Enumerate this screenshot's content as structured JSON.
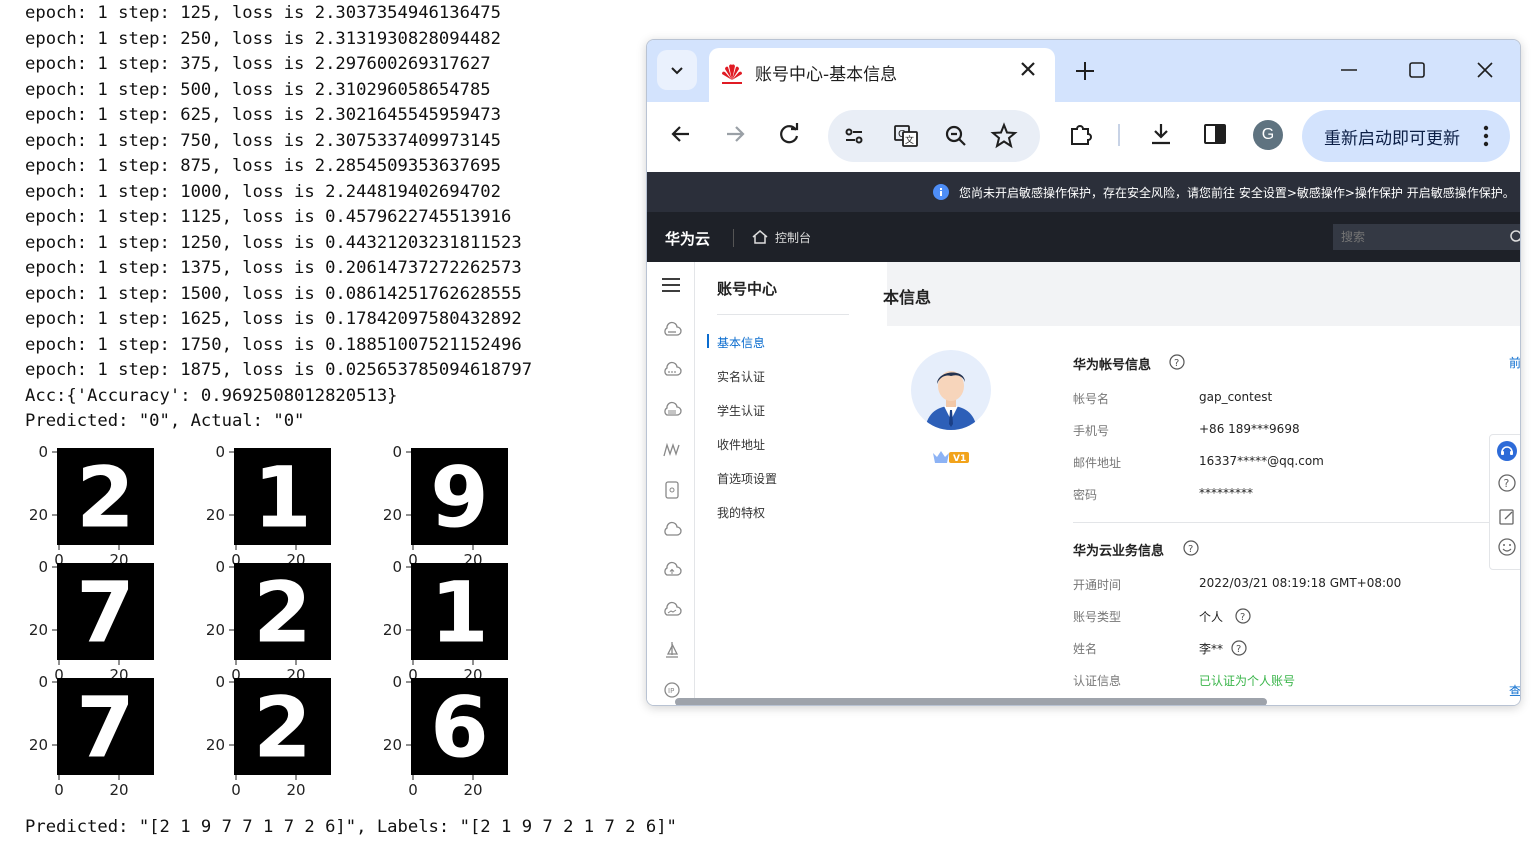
{
  "terminal": {
    "log_lines": [
      "epoch: 1 step: 125, loss is 2.3037354946136475",
      "epoch: 1 step: 250, loss is 2.3131930828094482",
      "epoch: 1 step: 375, loss is 2.297600269317627",
      "epoch: 1 step: 500, loss is 2.310296058654785",
      "epoch: 1 step: 625, loss is 2.3021645545959473",
      "epoch: 1 step: 750, loss is 2.3075337409973145",
      "epoch: 1 step: 875, loss is 2.2854509353637695",
      "epoch: 1 step: 1000, loss is 2.244819402694702",
      "epoch: 1 step: 1125, loss is 0.4579622745513916",
      "epoch: 1 step: 1250, loss is 0.44321203231811523",
      "epoch: 1 step: 1375, loss is 0.20614737272262573",
      "epoch: 1 step: 1500, loss is 0.08614251762628555",
      "epoch: 1 step: 1625, loss is 0.17842097580432892",
      "epoch: 1 step: 1750, loss is 0.18851007521152496",
      "epoch: 1 step: 1875, loss is 0.025653785094618797",
      "Acc:{'Accuracy': 0.9692508012820513}",
      "Predicted: \"0\", Actual: \"0\""
    ],
    "grid": {
      "digits": [
        "2",
        "1",
        "9",
        "7",
        "2",
        "1",
        "7",
        "2",
        "6"
      ],
      "tick_labels": [
        "0",
        "20"
      ]
    },
    "bottom_line": "Predicted: \"[2 1 9 7 7 1 7 2 6]\", Labels: \"[2 1 9 7 2 1 7 2 6]\""
  },
  "browser": {
    "tab": {
      "title": "账号中心-基本信息",
      "favicon": "huawei-logo-icon"
    },
    "toolbar": {
      "relaunch_label": "重新启动即可更新",
      "profile_initial": "G"
    },
    "notice": "您尚未开启敏感操作保护，存在安全风险，请您前往 安全设置>敏感操作>操作保护 开启敏感操作保护。",
    "topnav": {
      "brand": "华为云",
      "console": "控制台",
      "search_placeholder": "搜索"
    },
    "side_menu": {
      "title": "账号中心",
      "items": [
        "基本信息",
        "实名认证",
        "学生认证",
        "收件地址",
        "首选项设置",
        "我的特权"
      ],
      "active_index": 0
    },
    "content": {
      "title": "基本信息",
      "title_visible": "本信息",
      "badge": "V1",
      "account_section": {
        "title": "华为帐号信息",
        "rows": [
          {
            "label": "帐号名",
            "value": "gap_contest"
          },
          {
            "label": "手机号",
            "value": "+86 189***9698"
          },
          {
            "label": "邮件地址",
            "value": "16337*****@qq.com"
          },
          {
            "label": "密码",
            "value": "*********"
          }
        ],
        "edge_text": "前"
      },
      "cloud_section": {
        "title": "华为云业务信息",
        "rows": [
          {
            "label": "开通时间",
            "value": "2022/03/21 08:19:18 GMT+08:00"
          },
          {
            "label": "账号类型",
            "value": "个人"
          },
          {
            "label": "姓名",
            "value": "李**"
          },
          {
            "label": "认证信息",
            "value": "已认证为个人账号"
          }
        ],
        "edge_text": "查"
      }
    },
    "colors": {
      "accent": "#0a6ccf",
      "verified": "#3ab54a",
      "tab_strip": "#d3e3fd"
    }
  }
}
